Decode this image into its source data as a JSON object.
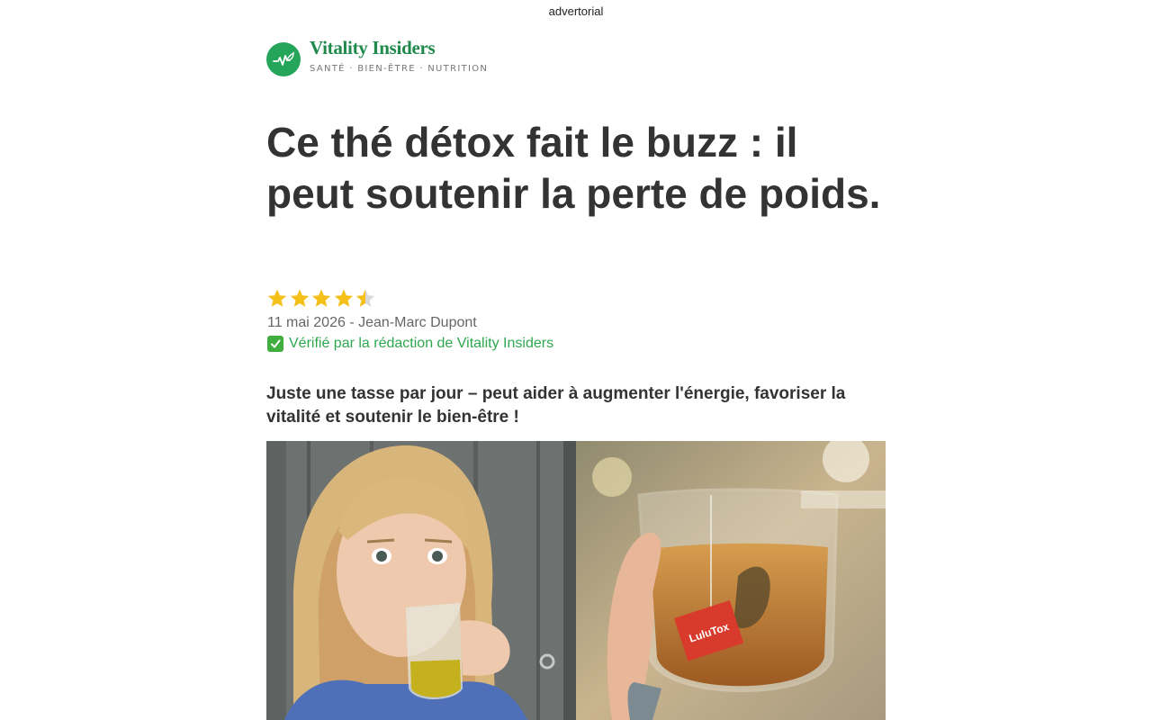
{
  "topbar": {
    "label": "advertorial"
  },
  "brand": {
    "name": "Vitality Insiders",
    "tagline": "SANTÉ · BIEN-ÊTRE · NUTRITION",
    "logo_icon": "heartbeat-leaf-icon",
    "color": "#25a55a"
  },
  "article": {
    "headline": "Ce thé détox fait le buzz : il peut soutenir la perte de poids.",
    "rating": 4.5,
    "rating_max": 5,
    "meta": "11 mai 2026 - Jean-Marc Dupont",
    "verified": "Vérifié par la rédaction de Vitality Insiders",
    "verified_icon": "check-mark-button-icon",
    "subhead": "Juste une tasse par jour – peut aider à augmenter l'énergie, favoriser la vitalité et soutenir le bien-être !"
  },
  "images": {
    "left_photo": "woman drinking tea from glass cup",
    "right_photo": "hand holding glass of tea with tea bag",
    "tea_bag_label": "LuluTox"
  }
}
